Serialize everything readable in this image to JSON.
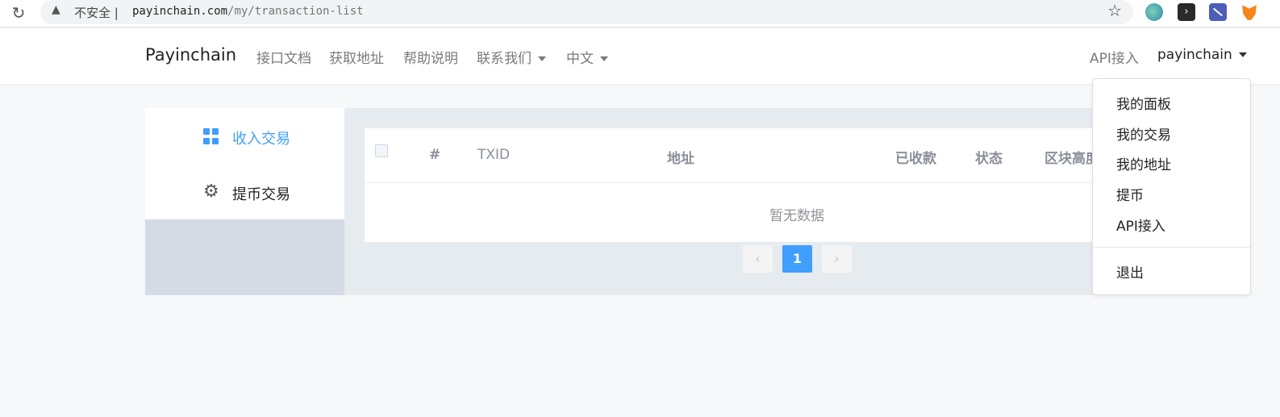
{
  "browser": {
    "insecure_label": "不安全",
    "url_host": "payinchain.com",
    "url_path": "/my/transaction-list",
    "reload_icon": "reload-icon",
    "star_icon": "star-icon"
  },
  "navbar": {
    "brand": "Payinchain",
    "links": [
      "接口文档",
      "获取地址",
      "帮助说明"
    ],
    "contact_label": "联系我们",
    "language_label": "中文",
    "api_label": "API接入",
    "user_label": "payinchain"
  },
  "user_menu": {
    "items": [
      "我的面板",
      "我的交易",
      "我的地址",
      "提币",
      "API接入"
    ],
    "logout": "退出"
  },
  "sidebar": {
    "items": [
      {
        "label": "收入交易",
        "icon": "grid-icon",
        "active": true,
        "color": "#409eff"
      },
      {
        "label": "提币交易",
        "icon": "gear-icon",
        "active": false
      }
    ]
  },
  "table": {
    "columns": [
      "#",
      "TXID",
      "地址",
      "已收款",
      "状态",
      "区块高度"
    ],
    "rows": [],
    "empty_text": "暂无数据"
  },
  "pagination": {
    "current_page": "1",
    "prev_icon": "chevron-left-icon",
    "next_icon": "chevron-right-icon"
  },
  "colors": {
    "accent": "#409eff",
    "sidebar_bg": "#d5dbe4",
    "panel_bg": "#e6ebf0"
  }
}
